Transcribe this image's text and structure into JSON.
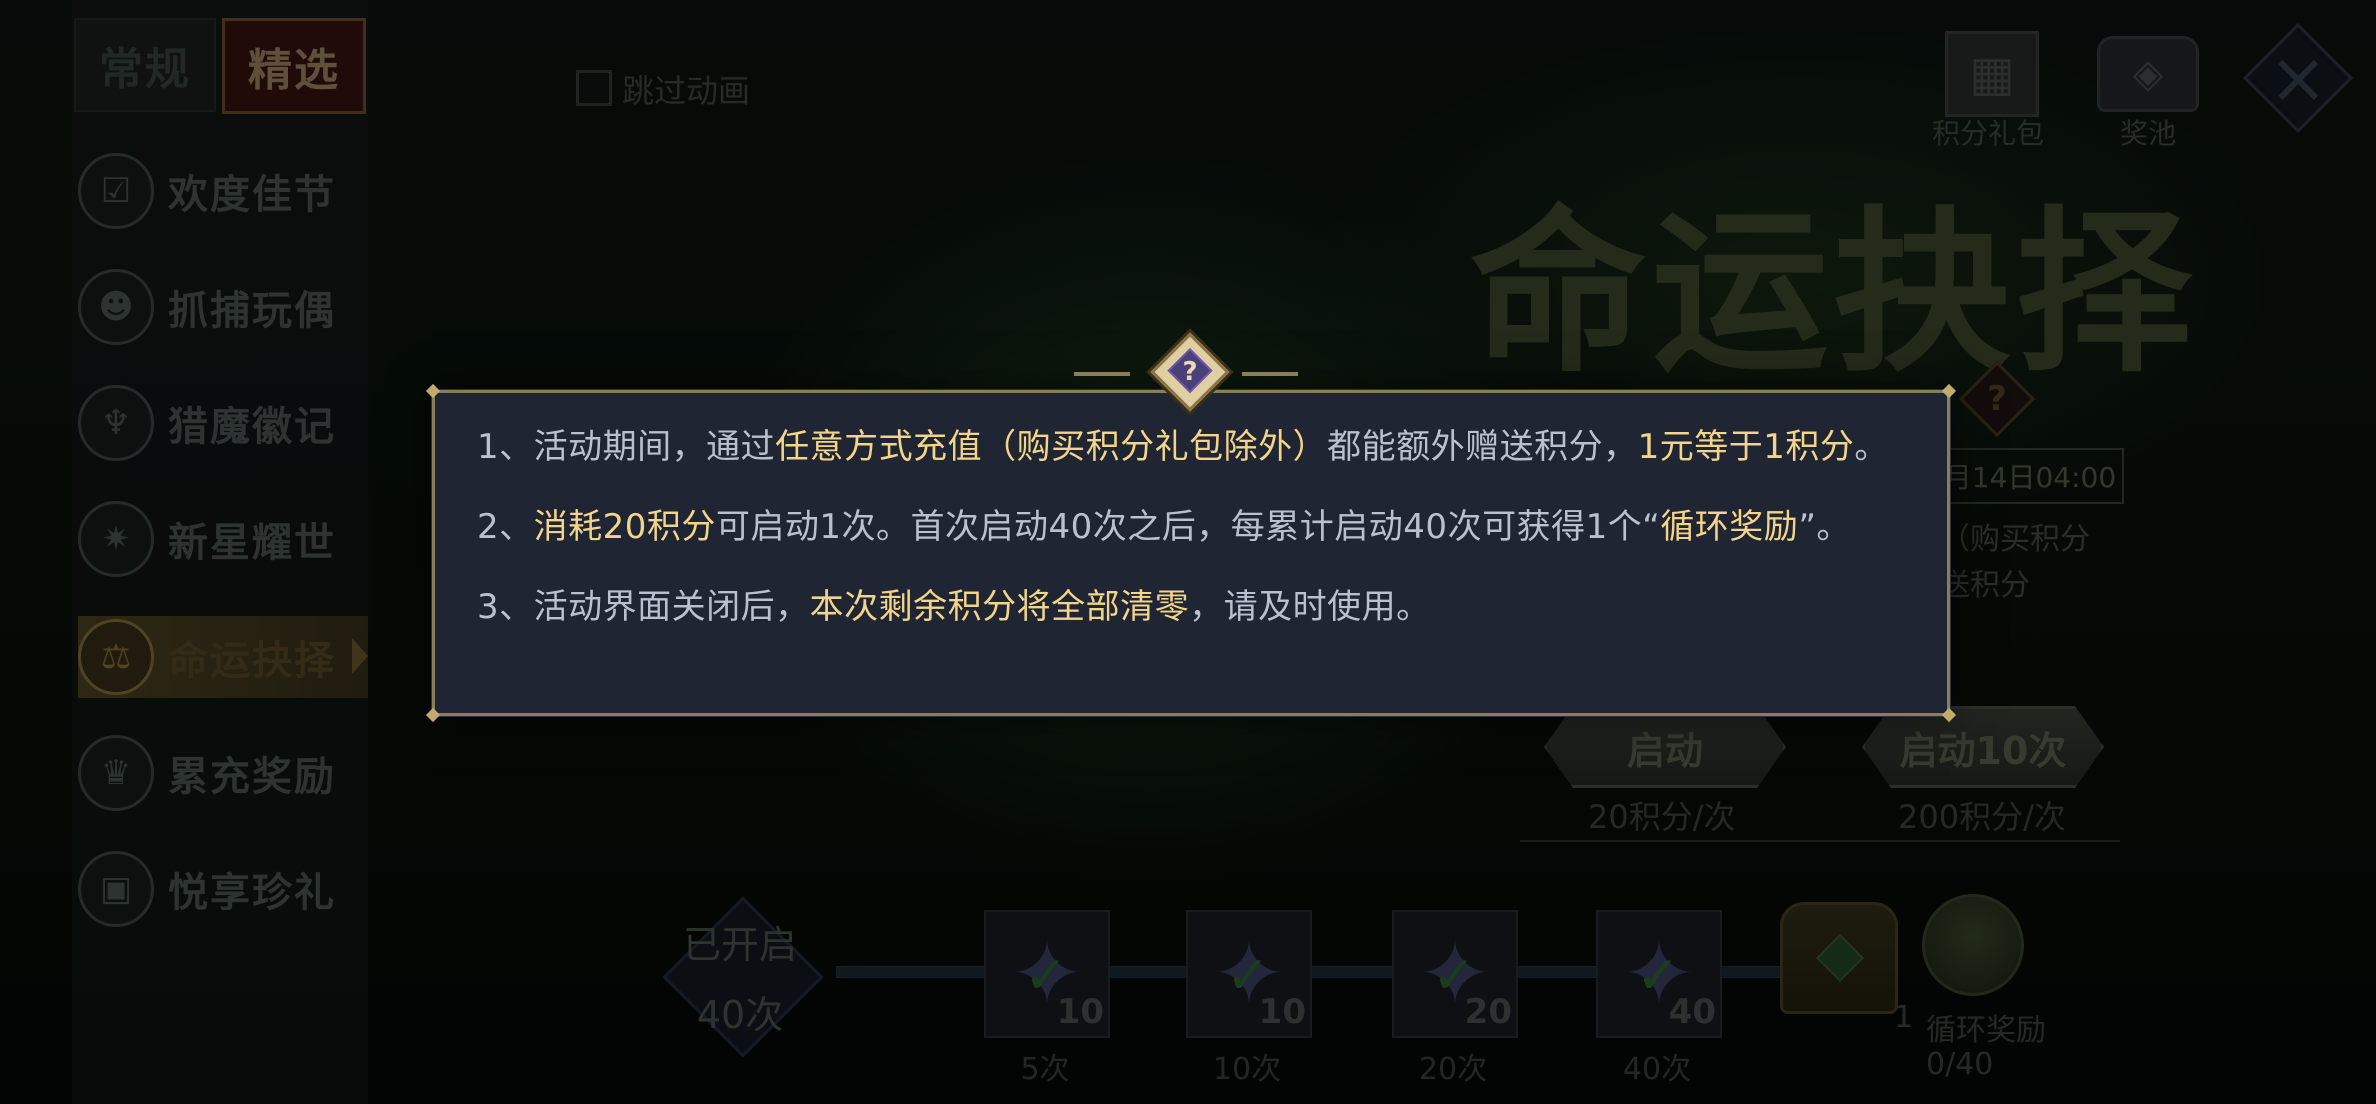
{
  "tabs": {
    "regular": "常规",
    "featured": "精选"
  },
  "sidebar": {
    "items": [
      {
        "label": "欢度佳节",
        "icon": "calendar-check-icon"
      },
      {
        "label": "抓捕玩偶",
        "icon": "claw-doll-icon"
      },
      {
        "label": "猎魔徽记",
        "icon": "demon-crest-icon"
      },
      {
        "label": "新星耀世",
        "icon": "star-burst-icon"
      },
      {
        "label": "命运抉择",
        "icon": "fate-choice-icon"
      },
      {
        "label": "累充奖励",
        "icon": "recharge-reward-icon"
      },
      {
        "label": "悦享珍礼",
        "icon": "gift-box-icon"
      }
    ],
    "active_index": 4
  },
  "skip_animation": {
    "label": "跳过动画",
    "checked": false
  },
  "top_right": {
    "points_gift_label": "积分礼包",
    "prize_pool_label": "奖池"
  },
  "event": {
    "title": "命运抉择",
    "time_partial": "月14日04:00",
    "desc_partial_1": "（购买积分",
    "desc_partial_2": "送积分"
  },
  "start_buttons": [
    {
      "label": "启动",
      "cost": "20积分/次"
    },
    {
      "label": "启动10次",
      "cost": "200积分/次"
    }
  ],
  "progress": {
    "opened_label": "已开启",
    "opened_count": "40次",
    "milestones": [
      {
        "reward_count": "10",
        "label": "5次",
        "completed": true
      },
      {
        "reward_count": "10",
        "label": "10次",
        "completed": true
      },
      {
        "reward_count": "20",
        "label": "20次",
        "completed": true
      },
      {
        "reward_count": "40",
        "label": "40次",
        "completed": true
      }
    ],
    "chest_count": "1",
    "cycle_reward_label": "循环奖励",
    "cycle_reward_progress": "0/40"
  },
  "modal": {
    "help_glyph": "?",
    "rules": [
      {
        "p1": "1、活动期间，通过",
        "h1": "任意方式充值（购买积分礼包除外）",
        "p2": "都能额外赠送积分，",
        "h2": "1元等于1积分",
        "p3": "。"
      },
      {
        "p1": "2、",
        "h1": "消耗20积分",
        "p2": "可启动1次。首次启动40次之后，每累计启动40次可获得1个“",
        "h2": "循环奖励",
        "p3": "”。"
      },
      {
        "p1": "3、活动界面关闭后，",
        "h1": "本次剩余积分将全部清零",
        "p2": "，请及时使用。",
        "h2": "",
        "p3": ""
      }
    ]
  },
  "colors": {
    "highlight": "#f2d58a",
    "modal_bg": "#1f2533",
    "modal_border": "#8a7d5a",
    "body_text": "#b9c0cf"
  }
}
